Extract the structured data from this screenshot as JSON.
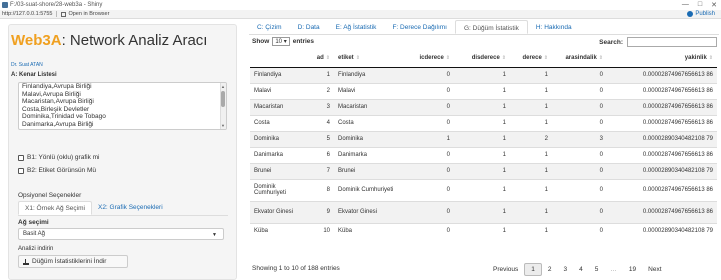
{
  "window": {
    "title": "F:/03-suat-shore/28-web3a - Shiny",
    "url": "http://127.0.0.1:5755",
    "open_browser": "Open in Browser",
    "publish": "Publish",
    "controls": [
      "—",
      "□",
      "✕"
    ]
  },
  "sidebar": {
    "title_brand": "Web3A",
    "title_rest": ": Network Analiz Aracı",
    "author": "Dr. Suat ATAN",
    "list_label": "A: Kenar Listesi",
    "edge_list": [
      "Finlandiya,Avrupa Birliği",
      "Malavi,Avrupa Birliği",
      "Macaristan,Avrupa Birliği",
      "Costa,Birleşik Devletler",
      "Dominika,Trinidad ve Tobago",
      "Danimarka,Avrupa Birliği"
    ],
    "checkbox1": "B1: Yönlü (oklu) grafik mi",
    "checkbox2": "B2: Etiket Görünsün Mü",
    "options_label": "Opsiyonel Seçenekler",
    "subtabs": [
      "X1: Örnek Ağ Seçimi",
      "X2: Grafik Seçenekleri"
    ],
    "network_label": "Ağ seçimi",
    "network_value": "Basit Ağ",
    "analysis_label": "Analizi indirin",
    "download_label": "Düğüm İstatistiklerini İndir"
  },
  "tabs": [
    "C: Çizim",
    "D: Data",
    "E: Ağ İstatistik",
    "F: Derece Dağılımı",
    "G: Düğüm İstatistik",
    "H: Hakkında"
  ],
  "active_tab": 4,
  "table_controls": {
    "show_label": "Show",
    "show_value": "10",
    "entries_label": "entries",
    "search_label": "Search:"
  },
  "chart_data": {
    "type": "table",
    "columns": [
      "",
      "ad",
      "etiket",
      "icderece",
      "disderece",
      "derece",
      "arasindalik",
      "yakinlik"
    ],
    "rows": [
      [
        "Finlandiya",
        "1",
        "Finlandiya",
        "0",
        "1",
        "1",
        "0",
        "0.00002874967656613 86"
      ],
      [
        "Malavi",
        "2",
        "Malavi",
        "0",
        "1",
        "1",
        "0",
        "0.00002874967656613 86"
      ],
      [
        "Macaristan",
        "3",
        "Macaristan",
        "0",
        "1",
        "1",
        "0",
        "0.00002874967656613 86"
      ],
      [
        "Costa",
        "4",
        "Costa",
        "0",
        "1",
        "1",
        "0",
        "0.00002874967656613 86"
      ],
      [
        "Dominika",
        "5",
        "Dominika",
        "1",
        "1",
        "2",
        "3",
        "0.00002890340482108 79"
      ],
      [
        "Danimarka",
        "6",
        "Danimarka",
        "0",
        "1",
        "1",
        "0",
        "0.00002874967656613 86"
      ],
      [
        "Brunei",
        "7",
        "Brunei",
        "0",
        "1",
        "1",
        "0",
        "0.00002890340482108 79"
      ],
      [
        "Dominik Cumhuriyeti",
        "8",
        "Dominik Cumhuriyeti",
        "0",
        "1",
        "1",
        "0",
        "0.00002874967656613 86"
      ],
      [
        "Ekvator Ginesi",
        "9",
        "Ekvator Ginesi",
        "0",
        "1",
        "1",
        "0",
        "0.00002874967656613 86"
      ],
      [
        "Küba",
        "10",
        "Küba",
        "0",
        "1",
        "1",
        "0",
        "0.00002890340482108 79"
      ]
    ]
  },
  "footer": {
    "info": "Showing 1 to 10 of 188 entries",
    "pages": [
      "Previous",
      "1",
      "2",
      "3",
      "4",
      "5",
      "…",
      "19",
      "Next"
    ],
    "current_page": "1"
  }
}
